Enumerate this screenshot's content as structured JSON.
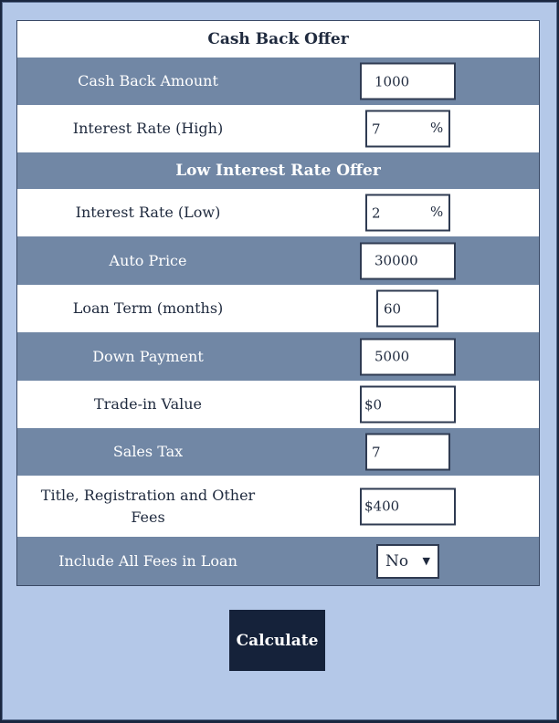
{
  "sections": {
    "cash_back": "Cash Back Offer",
    "low_interest": "Low Interest Rate Offer"
  },
  "fields": {
    "cash_back_amount": {
      "label": "Cash Back Amount",
      "value": "1000"
    },
    "interest_high": {
      "label": "Interest Rate (High)",
      "value": "7",
      "unit": "%"
    },
    "interest_low": {
      "label": "Interest Rate (Low)",
      "value": "2",
      "unit": "%"
    },
    "auto_price": {
      "label": "Auto Price",
      "value": "30000"
    },
    "loan_term": {
      "label": "Loan Term (months)",
      "value": "60"
    },
    "down_payment": {
      "label": "Down Payment",
      "value": "5000"
    },
    "trade_in": {
      "label": "Trade-in Value",
      "value": "$0"
    },
    "sales_tax": {
      "label": "Sales Tax",
      "value": "7"
    },
    "fees": {
      "label": "Title, Registration and Other Fees",
      "value": "$400"
    },
    "include_fees": {
      "label": "Include All Fees in Loan",
      "value": "No",
      "icon": "caret-down-icon"
    }
  },
  "calculate_label": "Calculate",
  "colors": {
    "background": "#b4c8e8",
    "row_dark": "#7187a5",
    "button": "#15223a"
  }
}
